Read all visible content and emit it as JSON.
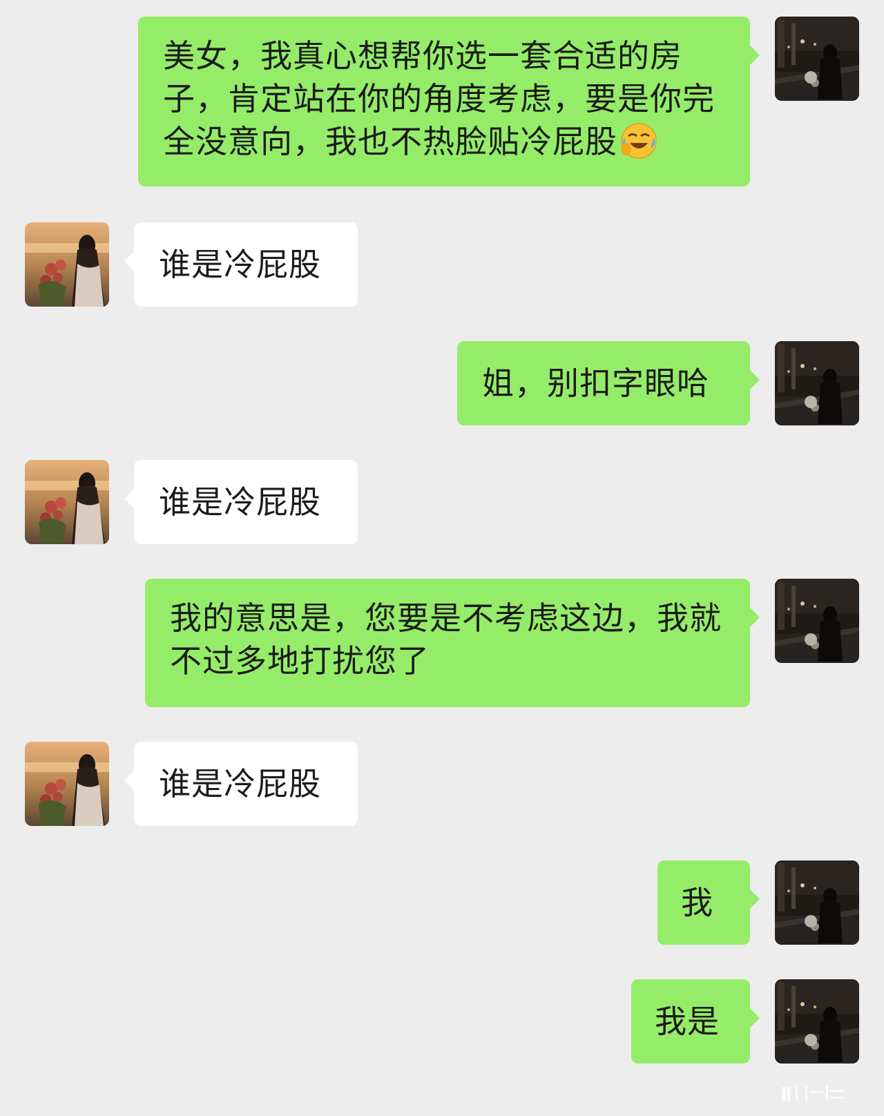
{
  "messages": [
    {
      "side": "out",
      "text": "美女，我真心想帮你选一套合适的房子，肯定站在你的角度考虑，要是你完全没意向，我也不热脸贴冷屁股",
      "emoji": "crying-laughing-emoji"
    },
    {
      "side": "in",
      "text": "谁是冷屁股"
    },
    {
      "side": "out",
      "text": "姐，别扣字眼哈"
    },
    {
      "side": "in",
      "text": "谁是冷屁股"
    },
    {
      "side": "out",
      "text": "我的意思是，您要是不考虑这边，我就不过多地打扰您了"
    },
    {
      "side": "in",
      "text": "谁是冷屁股"
    },
    {
      "side": "out",
      "text": "我"
    },
    {
      "side": "out",
      "text": "我是"
    }
  ],
  "colors": {
    "background": "#ededed",
    "outgoing_bubble": "#95ec69",
    "incoming_bubble": "#ffffff",
    "text": "#1b1b1b"
  },
  "icons": {
    "self_avatar": "night-street-girl-avatar",
    "contact_avatar": "sunset-girl-avatar",
    "watermark": "watermark-logo"
  }
}
